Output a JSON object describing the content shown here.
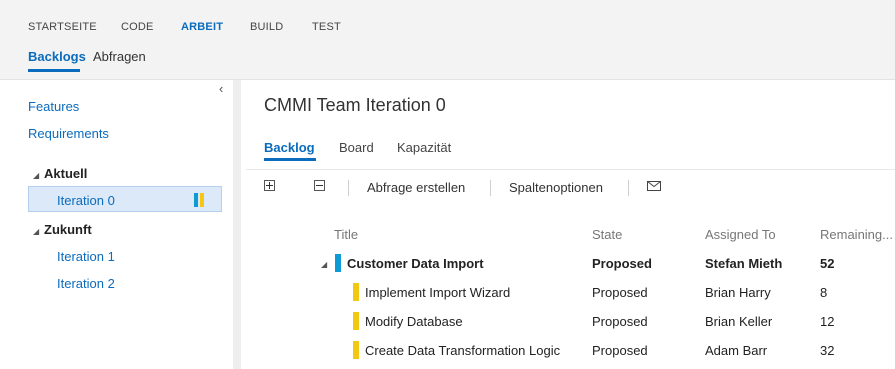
{
  "hubs": [
    "STARTSEITE",
    "CODE",
    "ARBEIT",
    "BUILD",
    "TEST"
  ],
  "hub_active": "ARBEIT",
  "subnav": [
    "Backlogs",
    "Abfragen"
  ],
  "left": {
    "collapse_glyph": "‹",
    "links": [
      "Features",
      "Requirements"
    ],
    "current_group": "Aktuell",
    "current_iteration": "Iteration 0",
    "future_group": "Zukunft",
    "future_iterations": [
      "Iteration 1",
      "Iteration 2"
    ],
    "group_glyph": "◢"
  },
  "main": {
    "title": "CMMI Team Iteration 0",
    "tabs": [
      "Backlog",
      "Board",
      "Kapazität"
    ],
    "toolbar": {
      "expand_icon": "expand-all-icon",
      "collapse_icon": "collapse-all-icon",
      "create_query": "Abfrage erstellen",
      "column_options": "Spaltenoptionen",
      "mail_icon": "mail-icon"
    },
    "columns": [
      "Title",
      "State",
      "Assigned To",
      "Remaining..."
    ],
    "rows": [
      {
        "title": "Customer Data Import",
        "state": "Proposed",
        "assigned": "Stefan Mieth",
        "remaining": "52",
        "parent": true
      },
      {
        "title": "Implement Import Wizard",
        "state": "Proposed",
        "assigned": "Brian Harry",
        "remaining": "8",
        "parent": false
      },
      {
        "title": "Modify Database",
        "state": "Proposed",
        "assigned": "Brian Keller",
        "remaining": "12",
        "parent": false
      },
      {
        "title": "Create Data Transformation Logic",
        "state": "Proposed",
        "assigned": "Adam Barr",
        "remaining": "32",
        "parent": false
      }
    ]
  },
  "colors": {
    "accent": "#0b6bbd",
    "requirement_bar": "#0e9ad6",
    "task_bar": "#f2c813",
    "selection_bg": "#dbe9f9"
  }
}
